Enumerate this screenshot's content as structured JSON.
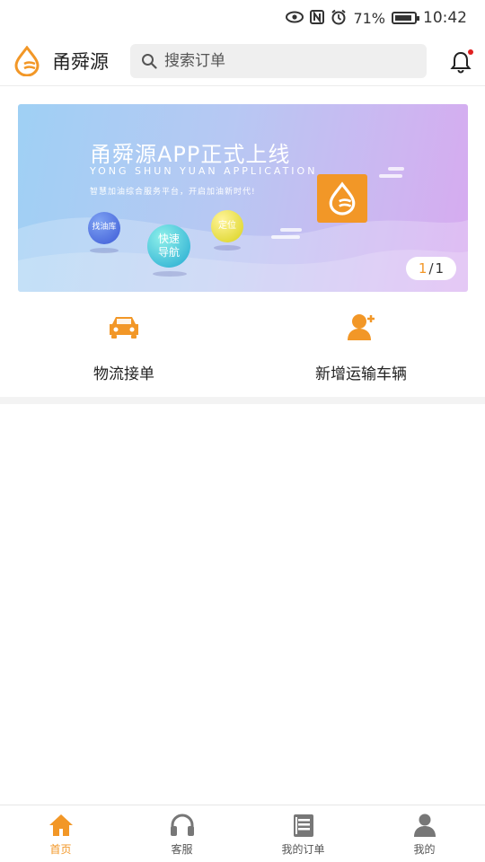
{
  "status_bar": {
    "battery_percent": "71%",
    "time": "10:42",
    "icons": [
      "eye-icon",
      "nfc-icon",
      "alarm-icon",
      "battery-icon"
    ]
  },
  "header": {
    "app_name": "甬舜源",
    "search_placeholder": "搜索订单",
    "has_notification_dot": true
  },
  "banner": {
    "title": "甬舜源APP正式上线",
    "subtitle": "YONG SHUN YUAN APPLICATION",
    "description": "智慧加油综合服务平台，开启加油新时代!",
    "bubbles": [
      "找油库",
      "快速\n导航",
      "定位"
    ],
    "pager_current": "1",
    "pager_sep": "/",
    "pager_total": "1"
  },
  "quick_actions": [
    {
      "label": "物流接单",
      "icon": "car-icon"
    },
    {
      "label": "新增运输车辆",
      "icon": "add-user-icon"
    }
  ],
  "tabbar": {
    "items": [
      {
        "label": "首页",
        "icon": "home-icon",
        "active": true
      },
      {
        "label": "客服",
        "icon": "headset-icon",
        "active": false
      },
      {
        "label": "我的订单",
        "icon": "orders-icon",
        "active": false
      },
      {
        "label": "我的",
        "icon": "user-icon",
        "active": false
      }
    ]
  },
  "colors": {
    "accent": "#f29727",
    "notification": "#e02020"
  }
}
